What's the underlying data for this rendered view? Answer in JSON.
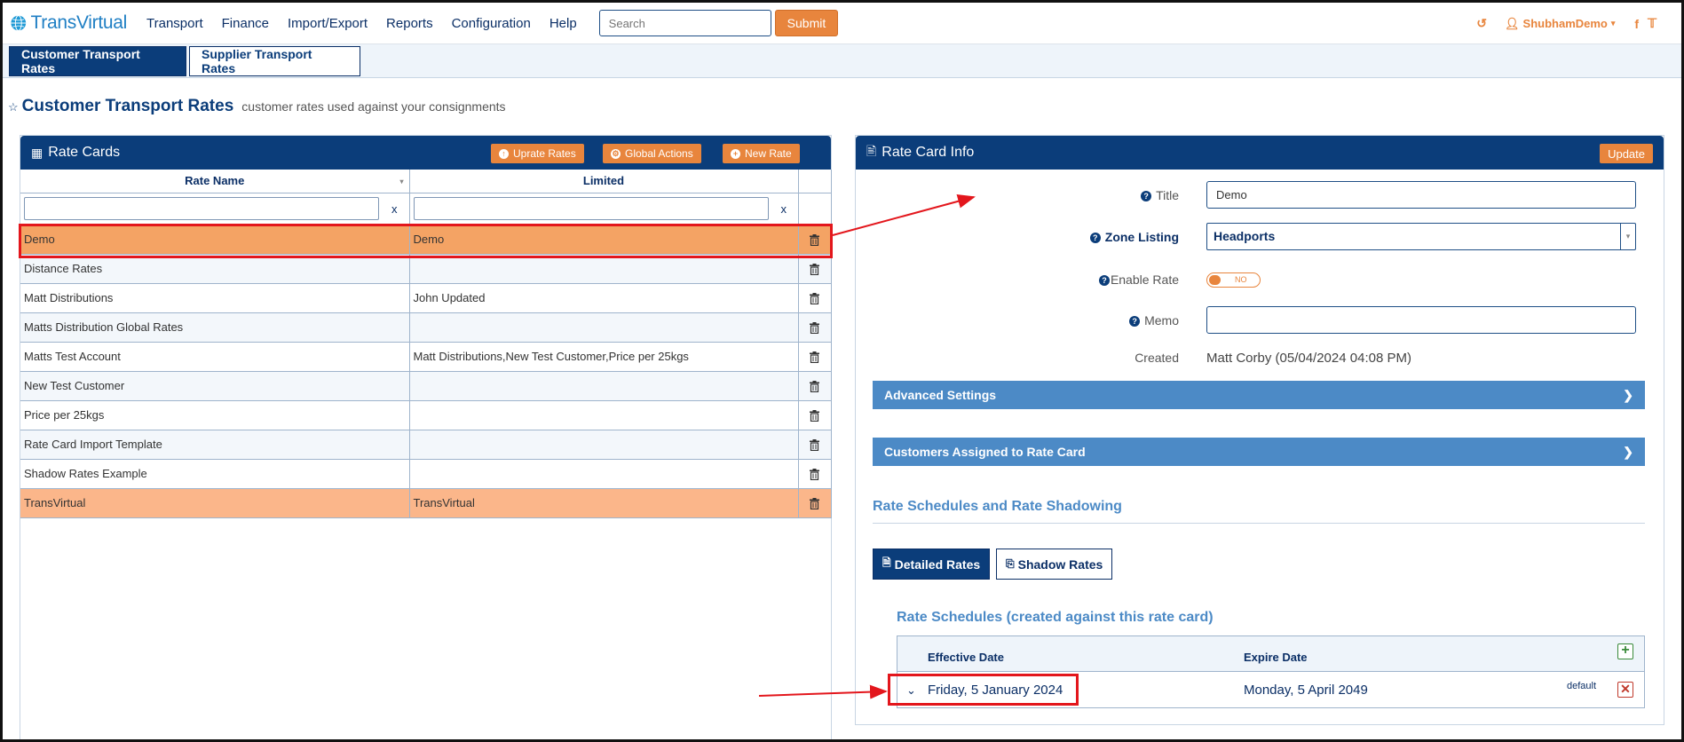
{
  "brand": {
    "name": "TransVirtual",
    "color": "#1f7fc4"
  },
  "nav": {
    "items": [
      "Transport",
      "Finance",
      "Import/Export",
      "Reports",
      "Configuration",
      "Help"
    ]
  },
  "search": {
    "placeholder": "Search",
    "submit_label": "Submit"
  },
  "user": {
    "name": "ShubhamDemo"
  },
  "tabs": {
    "customer": "Customer Transport Rates",
    "supplier": "Supplier Transport Rates"
  },
  "page": {
    "title": "Customer Transport Rates",
    "subtitle": "customer rates used against your consignments"
  },
  "rate_cards": {
    "title": "Rate Cards",
    "buttons": {
      "uprate": "Uprate Rates",
      "global": "Global Actions",
      "new": "New Rate"
    },
    "columns": {
      "name": "Rate Name",
      "limited": "Limited"
    },
    "filter_clear": "x",
    "rows": [
      {
        "name": "Demo",
        "limited": "Demo"
      },
      {
        "name": "Distance Rates",
        "limited": ""
      },
      {
        "name": "Matt Distributions",
        "limited": "John Updated"
      },
      {
        "name": "Matts Distribution Global Rates",
        "limited": ""
      },
      {
        "name": "Matts Test Account",
        "limited": "Matt Distributions,New Test Customer,Price per 25kgs"
      },
      {
        "name": "New Test Customer",
        "limited": ""
      },
      {
        "name": "Price per 25kgs",
        "limited": ""
      },
      {
        "name": "Rate Card Import Template",
        "limited": ""
      },
      {
        "name": "Shadow Rates Example",
        "limited": ""
      },
      {
        "name": "TransVirtual",
        "limited": "TransVirtual"
      }
    ]
  },
  "info": {
    "title": "Rate Card Info",
    "update_label": "Update",
    "fields": {
      "title_label": "Title",
      "title_value": "Demo",
      "zone_label": "Zone Listing",
      "zone_value": "Headports",
      "enable_label": "Enable Rate",
      "enable_value": "NO",
      "memo_label": "Memo",
      "memo_value": "",
      "created_label": "Created",
      "created_value": "Matt Corby (05/04/2024 04:08 PM)"
    },
    "advanced": "Advanced Settings",
    "customers": "Customers Assigned to Rate Card",
    "schedules_heading": "Rate Schedules and Rate Shadowing",
    "subtabs": {
      "detailed": "Detailed Rates",
      "shadow": "Shadow Rates"
    },
    "schedules_title": "Rate Schedules (created against this rate card)",
    "schedule_cols": {
      "effective": "Effective Date",
      "expire": "Expire Date"
    },
    "schedules": [
      {
        "effective": "Friday, 5 January 2024",
        "expire": "Monday, 5 April 2049",
        "tag": "default"
      }
    ]
  },
  "colors": {
    "navy": "#0b3d7a",
    "orange": "#e8853d",
    "selected_row": "#f4a364",
    "accent_blue": "#4c8ac6",
    "annotation_red": "#e3161c"
  }
}
